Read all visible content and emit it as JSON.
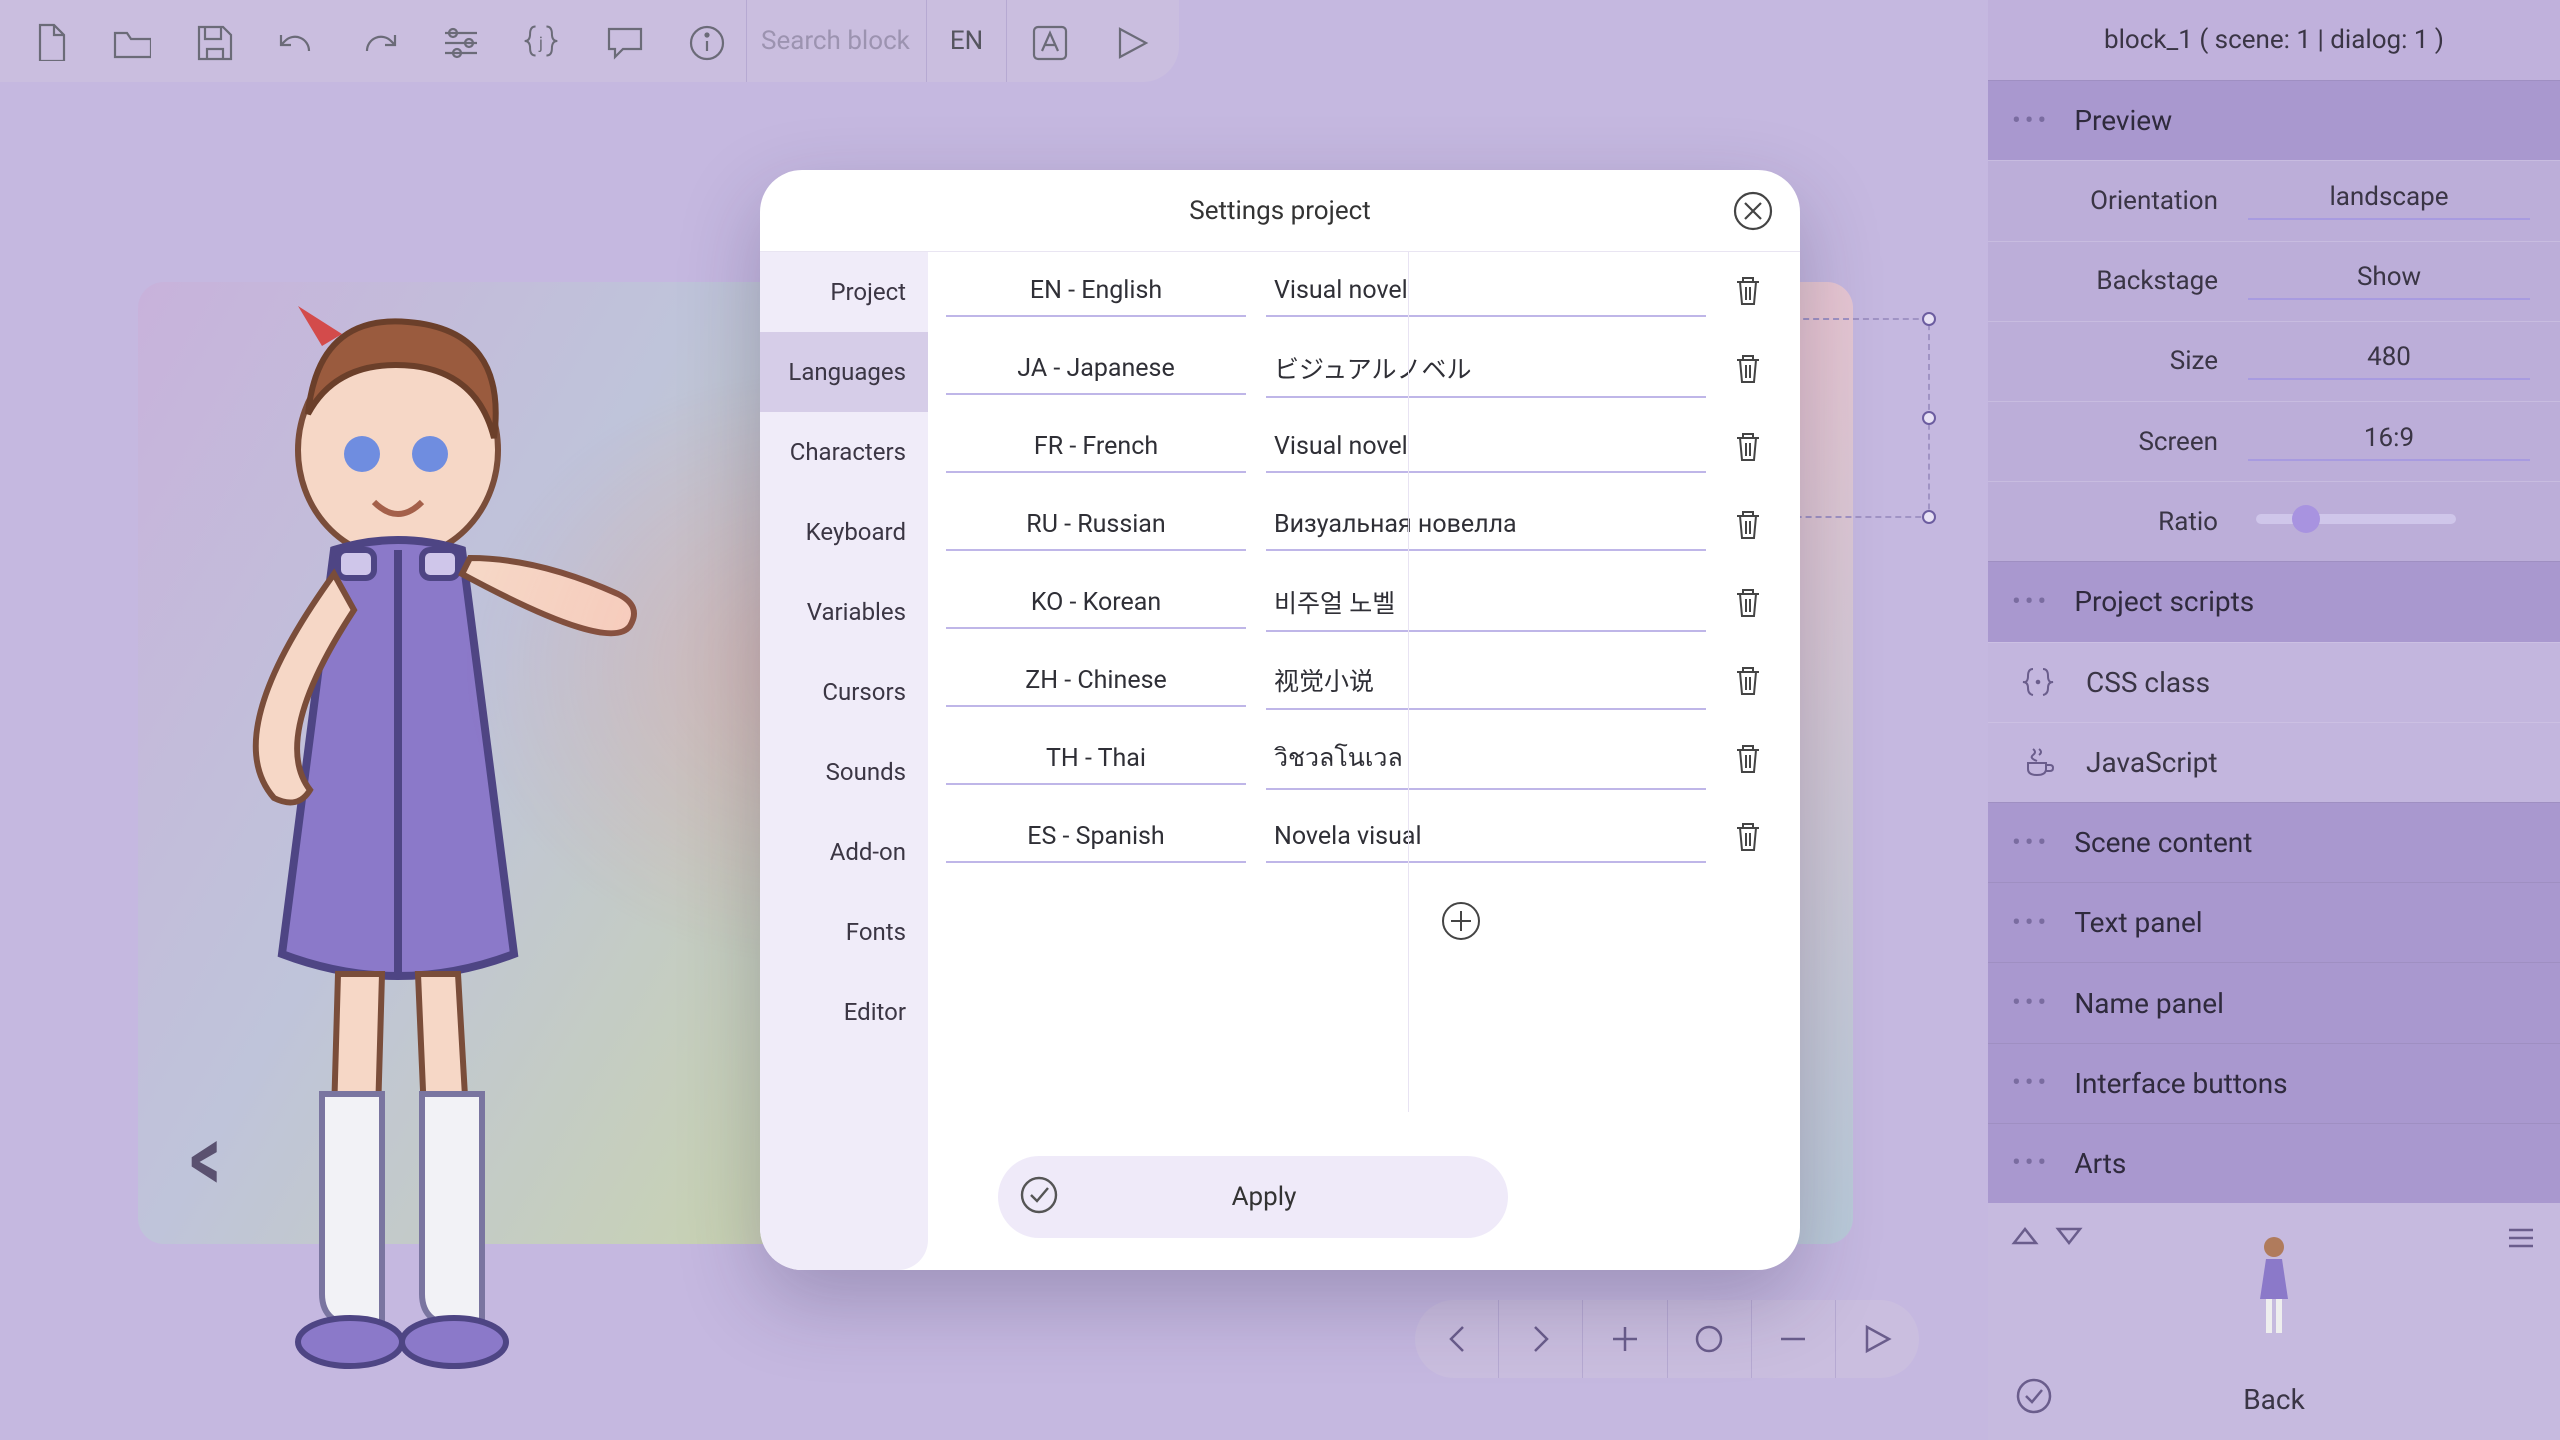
{
  "toolbar": {
    "search_placeholder": "Search block",
    "lang_code": "EN"
  },
  "header": {
    "block_label": "block_1 ( scene: 1 | dialog: 1 )"
  },
  "preview_panel": {
    "title": "Preview",
    "orientation_label": "Orientation",
    "orientation_value": "landscape",
    "backstage_label": "Backstage",
    "backstage_value": "Show",
    "size_label": "Size",
    "size_value": "480",
    "screen_label": "Screen",
    "screen_value": "16:9",
    "ratio_label": "Ratio"
  },
  "scripts_panel": {
    "title": "Project scripts",
    "css_label": "CSS class",
    "js_label": "JavaScript"
  },
  "sections": {
    "scene_content": "Scene content",
    "text_panel": "Text panel",
    "name_panel": "Name panel",
    "interface_buttons": "Interface buttons",
    "arts": "Arts"
  },
  "bottom": {
    "back_label": "Back"
  },
  "canvas": {
    "prev": "<"
  },
  "modal": {
    "title": "Settings project",
    "apply_label": "Apply",
    "tabs": {
      "project": "Project",
      "languages": "Languages",
      "characters": "Characters",
      "keyboard": "Keyboard",
      "variables": "Variables",
      "cursors": "Cursors",
      "sounds": "Sounds",
      "addon": "Add-on",
      "fonts": "Fonts",
      "editor": "Editor"
    },
    "languages": [
      {
        "code": "EN - English",
        "title": "Visual novel"
      },
      {
        "code": "JA - Japanese",
        "title": "ビジュアルノベル"
      },
      {
        "code": "FR - French",
        "title": "Visual novel"
      },
      {
        "code": "RU - Russian",
        "title": "Визуальная новелла"
      },
      {
        "code": "KO - Korean",
        "title": "비주얼 노벨"
      },
      {
        "code": "ZH - Chinese",
        "title": "视觉小说"
      },
      {
        "code": "TH - Thai",
        "title": "วิชวลโนเวล"
      },
      {
        "code": "ES - Spanish",
        "title": "Novela visual"
      }
    ]
  }
}
